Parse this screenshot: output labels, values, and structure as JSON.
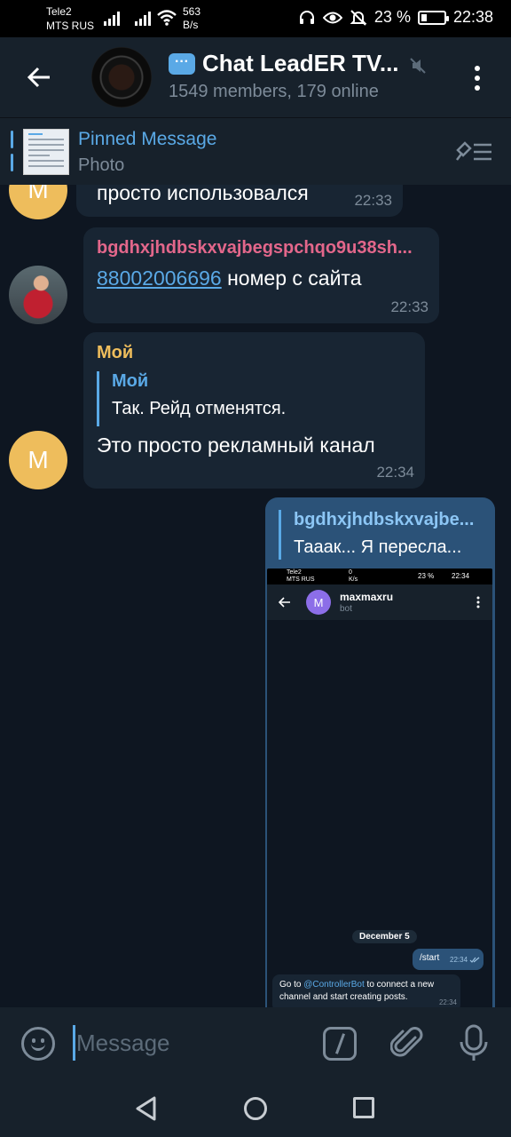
{
  "status_bar": {
    "carrier1": "Tele2",
    "carrier2": "MTS RUS",
    "speed_value": "563",
    "speed_unit": "B/s",
    "battery_percent": "23 %",
    "battery_level": 0.23,
    "time": "22:38"
  },
  "header": {
    "title": "Chat LeadER TV...",
    "subtitle": "1549 members, 179 online"
  },
  "pinned": {
    "title": "Pinned Message",
    "subtitle": "Photo"
  },
  "messages": [
    {
      "avatar_letter": "M",
      "text": "просто использовался",
      "time": "22:33"
    },
    {
      "sender": "bgdhxjhdbskxvajbegspchqo9u38sh...",
      "sender_color": "#e3678b",
      "link": "88002006696",
      "text": " номер с сайта",
      "time": "22:33"
    },
    {
      "avatar_letter": "M",
      "sender": "Мой",
      "sender_color": "#eebd5c",
      "reply_name": "Мой",
      "reply_text": "Так. Рейд отменятся.",
      "text": "Это просто рекламный канал",
      "time": "22:34"
    },
    {
      "reply_name": "bgdhxjhdbskxvajbe...",
      "reply_text": "Тааак... Я пересла...",
      "screenshot": {
        "carrier1": "Tele2",
        "carrier2": "MTS RUS",
        "speed_value": "0",
        "speed_unit": "K/s",
        "battery_percent": "23 %",
        "time": "22:34",
        "avatar_letter": "M",
        "name": "maxmaxru",
        "sub": "bot",
        "date": "December 5",
        "out_text": "/start",
        "out_time": "22:34",
        "in_text_prefix": "Go to ",
        "in_mention": "@ControllerBot",
        "in_text_suffix": " to connect a new channel and start creating posts.",
        "in_time": "22:34"
      }
    }
  ],
  "input": {
    "placeholder": "Message"
  },
  "colors": {
    "accent": "#5aa9e6",
    "bubble_in": "#182533",
    "bubble_out": "#2b5278",
    "background": "#0e1621",
    "bar": "#17212b"
  }
}
